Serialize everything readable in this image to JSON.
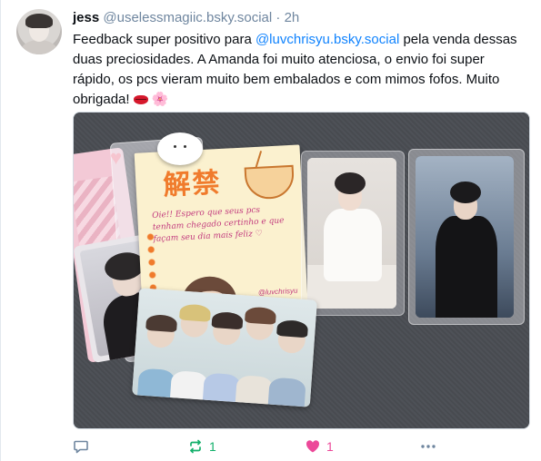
{
  "post": {
    "author_name": "jess",
    "handle": "@uselessmagiic.bsky.social",
    "separator": "·",
    "time": "2h",
    "text_before": "Feedback super positivo para ",
    "mention": "@luvchrisyu.bsky.social",
    "text_after": " pela venda dessas duas preciosidades. A Amanda foi muito atenciosa, o envio foi super rápido, os pcs vieram muito bem embalados e com mimos fofos. Muito obrigada!",
    "emoji_1": "lips",
    "emoji_2": "🌸"
  },
  "image": {
    "letter_title": "解禁",
    "letter_note": "Oie!! Espero que seus pcs tenham chegado certinho e que façam seu dia mais feliz ♡",
    "letter_signature": "@luvchrisyu"
  },
  "actions": {
    "reply_count": "",
    "repost_count": "1",
    "like_count": "1"
  },
  "icons": {
    "reply": "reply-icon",
    "repost": "repost-icon",
    "like": "heart-icon",
    "more": "more-options-icon"
  },
  "colors": {
    "mention": "#1083fe",
    "meta": "#6f869f",
    "repost_active": "#13b06b",
    "like_active": "#ec4899"
  }
}
